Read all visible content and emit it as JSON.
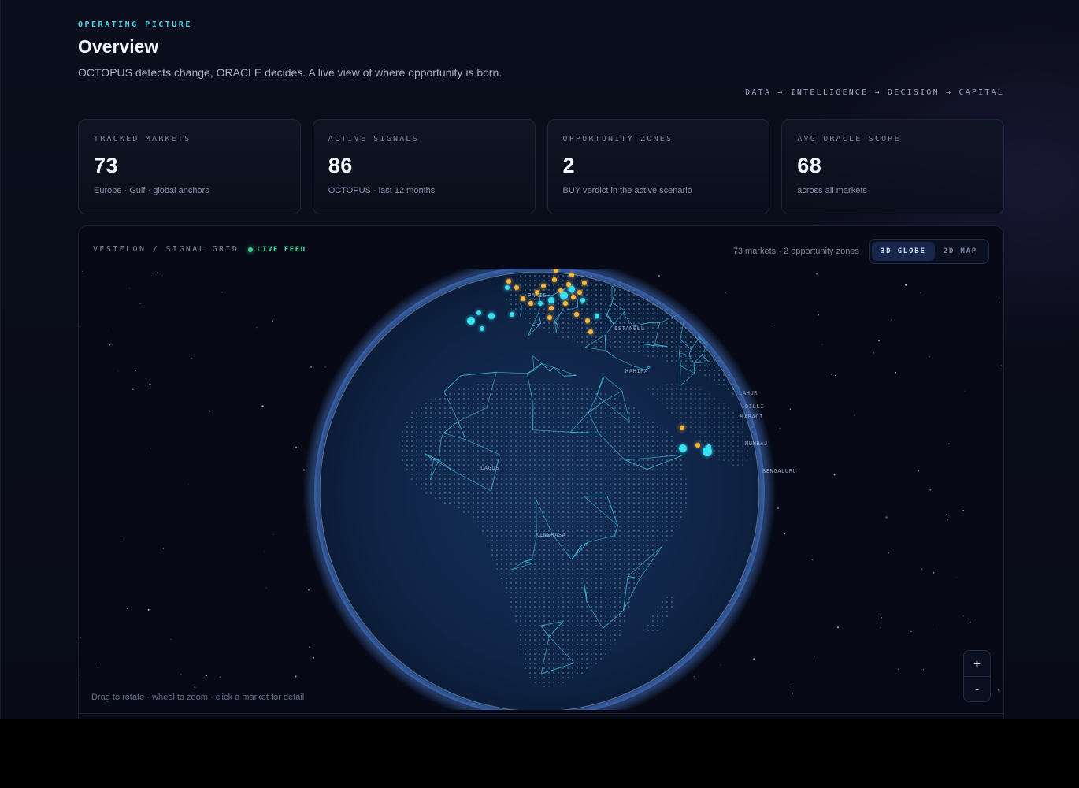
{
  "header": {
    "eyebrow": "OPERATING PICTURE",
    "title": "Overview",
    "subtitle": "OCTOPUS detects change, ORACLE decides. A live view of where opportunity is born.",
    "pipeline": "DATA → INTELLIGENCE → DECISION → CAPITAL"
  },
  "stats": [
    {
      "label": "TRACKED MARKETS",
      "value": "73",
      "caption": "Europe · Gulf · global anchors"
    },
    {
      "label": "ACTIVE SIGNALS",
      "value": "86",
      "caption": "OCTOPUS · last 12 months"
    },
    {
      "label": "OPPORTUNITY ZONES",
      "value": "2",
      "caption": "BUY verdict in the active scenario"
    },
    {
      "label": "AVG ORACLE SCORE",
      "value": "68",
      "caption": "across all markets"
    }
  ],
  "panel": {
    "title": "VESTELON / SIGNAL GRID",
    "live_label": "LIVE FEED",
    "counts": "73 markets · 2 opportunity zones",
    "view_toggle": {
      "options": [
        "3D GLOBE",
        "2D MAP"
      ],
      "selected": "3D GLOBE"
    },
    "hint": "Drag to rotate · wheel to zoom · click a market for detail",
    "zoom_in": "+",
    "zoom_out": "-"
  },
  "globe": {
    "city_labels": [
      "PARIS",
      "ISTANBUL",
      "KAHIRA",
      "LAHUR",
      "DILLI",
      "KARACI",
      "MUMBAJ",
      "BENGALURU",
      "LAGOS",
      "KINSHASA"
    ],
    "colors": {
      "signal": "#f6b73c",
      "opportunity": "#38e0f0",
      "grid": "#3fb6d8",
      "ocean": "#0f2446"
    }
  }
}
